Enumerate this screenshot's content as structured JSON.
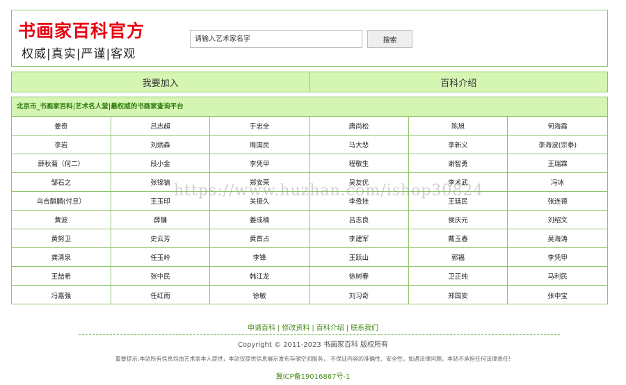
{
  "header": {
    "title": "书画家百科官方",
    "tagline": "权威|真实|严谨|客观",
    "search_placeholder": "请输入艺术家名字",
    "search_button": "搜索"
  },
  "nav": {
    "items": [
      {
        "label": "我要加入"
      },
      {
        "label": "百科介绍"
      }
    ]
  },
  "list": {
    "heading": "北京市_书画家百科|艺术名人堂|最权威的书画家查询平台",
    "names": [
      "姜奇",
      "吕志超",
      "于忠全",
      "唐尚松",
      "陈旭",
      "何海霞",
      "李岩",
      "刘炳森",
      "周国民",
      "马大悲",
      "李新义",
      "李海波(宗泰)",
      "薛秋菊（何二）",
      "段小金",
      "李凭甲",
      "程敬生",
      "谢智勇",
      "王瑞霖",
      "邹石之",
      "张锦镐",
      "郑安荣",
      "吴友优",
      "李术武",
      "冯冰",
      "乌合麒麟(付旦）",
      "王玉印",
      "关振久",
      "李卺挂",
      "王廷民",
      "张连德",
      "黄波",
      "薛镛",
      "姜成楠",
      "吕志良",
      "侯庆元",
      "刘绍文",
      "黄努卫",
      "史云芳",
      "黄首占",
      "李建军",
      "戴玉春",
      "吴海涛",
      "龚清泉",
      "任玉岭",
      "李锋",
      "王跃山",
      "郭福",
      "李凭甲",
      "王喆希",
      "张中民",
      "韩江龙",
      "徐树春",
      "卫正纯",
      "马利民",
      "冯嘉强",
      "任红雨",
      "徐敏",
      "刘习奇",
      "郑国安",
      "张中宝"
    ]
  },
  "watermark": "https://www.huzhan.com/ishop30824",
  "footer": {
    "links": [
      "申请百科",
      "修改资料",
      "百科介绍",
      "联系我们"
    ],
    "separator": "|",
    "copyright": "Copyright © 2011-2023 书画家百科 版权所有",
    "disclaimer": "重要提示:本站所有信息均由艺术家本人提供，本站仅提供信息展示发布存储空间服务， 不保证内容的准确性、安全性，如遇法律问题，本站不承担任何法律责任!",
    "icp": "冀ICP备19016867号-1"
  },
  "colors": {
    "brand_red": "#e60012",
    "accent_green": "#8cc56b",
    "nav_bg": "#d5f5b3",
    "link_green": "#4a8a1c"
  }
}
